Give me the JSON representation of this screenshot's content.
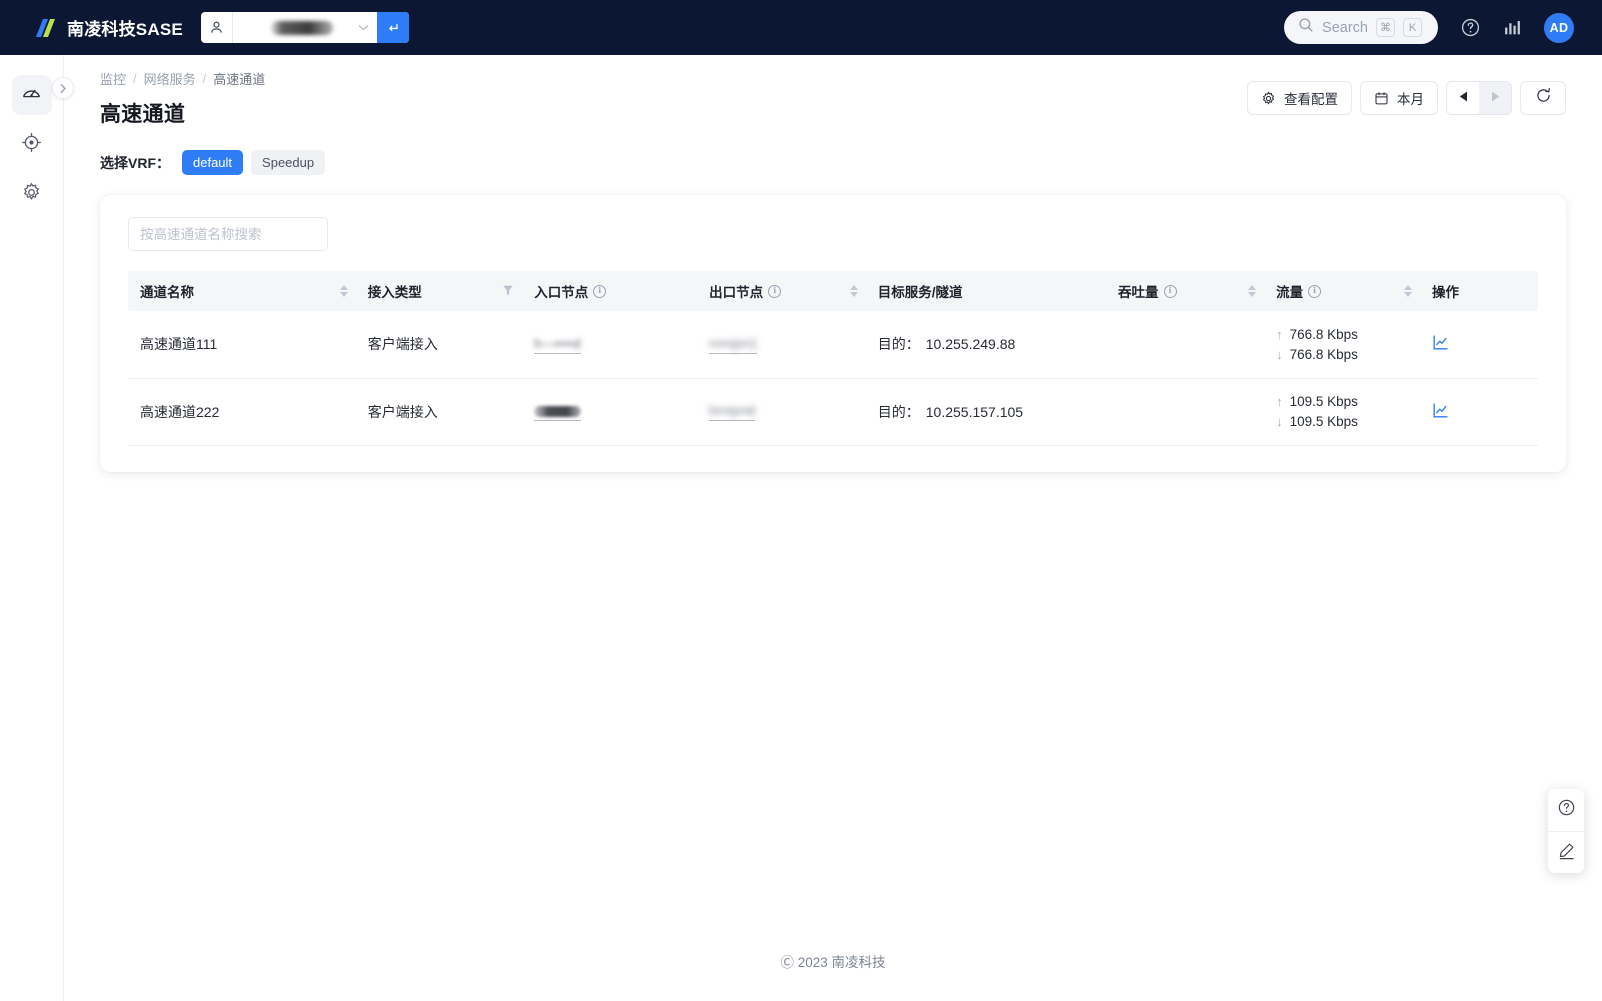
{
  "topbar": {
    "brand_name": "南凌科技SASE",
    "logo_icon": "slash-logo-icon",
    "tenant_selector": {
      "person_icon": "person-icon",
      "value": "",
      "value_redacted": true,
      "caret_icon": "chevron-down-icon",
      "go_icon": "enter-arrow-icon"
    },
    "search": {
      "icon": "search-icon",
      "label": "Search",
      "shortcut_keys": [
        "⌘",
        "K"
      ]
    },
    "help_icon": "question-circle-icon",
    "stats_icon": "bar-chart-icon",
    "avatar_initials": "AD"
  },
  "rail": {
    "expand_icon": "chevron-right-icon",
    "items": [
      {
        "name": "dashboard",
        "icon": "gauge-icon",
        "active": true
      },
      {
        "name": "locate",
        "icon": "target-icon",
        "active": false
      },
      {
        "name": "settings",
        "icon": "gear-icon",
        "active": false
      }
    ]
  },
  "breadcrumb": {
    "items": [
      "监控",
      "网络服务",
      "高速通道"
    ],
    "separator": "/"
  },
  "page": {
    "title": "高速通道"
  },
  "head_actions": {
    "view_config": {
      "label": "查看配置",
      "icon": "gear-icon"
    },
    "date_range": {
      "label": "本月",
      "icon": "calendar-icon"
    },
    "prev_icon": "triangle-left-icon",
    "next_icon": "triangle-right-icon",
    "refresh_icon": "refresh-icon"
  },
  "vrf": {
    "label": "选择VRF：",
    "tabs": [
      {
        "label": "default",
        "selected": true
      },
      {
        "label": "Speedup",
        "selected": false
      }
    ]
  },
  "table_search": {
    "placeholder": "按高速通道名称搜索",
    "value": "",
    "icon": "search-icon"
  },
  "table": {
    "columns": [
      {
        "key": "name",
        "label": "通道名称",
        "sortable": true,
        "filterable": false,
        "info": false
      },
      {
        "key": "access",
        "label": "接入类型",
        "sortable": false,
        "filterable": true,
        "info": false
      },
      {
        "key": "ingress",
        "label": "入口节点",
        "sortable": false,
        "filterable": false,
        "info": true
      },
      {
        "key": "egress",
        "label": "出口节点",
        "sortable": true,
        "filterable": false,
        "info": true
      },
      {
        "key": "target",
        "label": "目标服务/隧道",
        "sortable": false,
        "filterable": false,
        "info": false
      },
      {
        "key": "throughput",
        "label": "吞吐量",
        "sortable": true,
        "filterable": false,
        "info": true
      },
      {
        "key": "flow",
        "label": "流量",
        "sortable": true,
        "filterable": false,
        "info": true
      },
      {
        "key": "actions",
        "label": "操作",
        "sortable": false,
        "filterable": false,
        "info": false
      }
    ],
    "rows": [
      {
        "name": "高速通道111",
        "access": "客户端接入",
        "ingress_redacted": true,
        "egress_redacted": true,
        "target_label": "目的：",
        "target_value": "10.255.249.88",
        "throughput": "",
        "flow_up": "766.8 Kbps",
        "flow_down": "766.8 Kbps",
        "up_arrow": "↑",
        "down_arrow": "↓",
        "action_icon": "line-chart-icon"
      },
      {
        "name": "高速通道222",
        "access": "客户端接入",
        "ingress_redacted": true,
        "egress_redacted": true,
        "target_label": "目的：",
        "target_value": "10.255.157.105",
        "throughput": "",
        "flow_up": "109.5 Kbps",
        "flow_down": "109.5 Kbps",
        "up_arrow": "↑",
        "down_arrow": "↓",
        "action_icon": "line-chart-icon"
      }
    ]
  },
  "dock": {
    "help_icon": "question-circle-icon",
    "edit_icon": "pencil-icon"
  },
  "footer": {
    "text": "Ⓒ 2023 南凌科技"
  },
  "colors": {
    "accent": "#2f7df6",
    "topbar_bg": "#0b1733",
    "header_bg": "#f5f6f8",
    "text": "#272b34",
    "muted": "#98a0ae"
  }
}
